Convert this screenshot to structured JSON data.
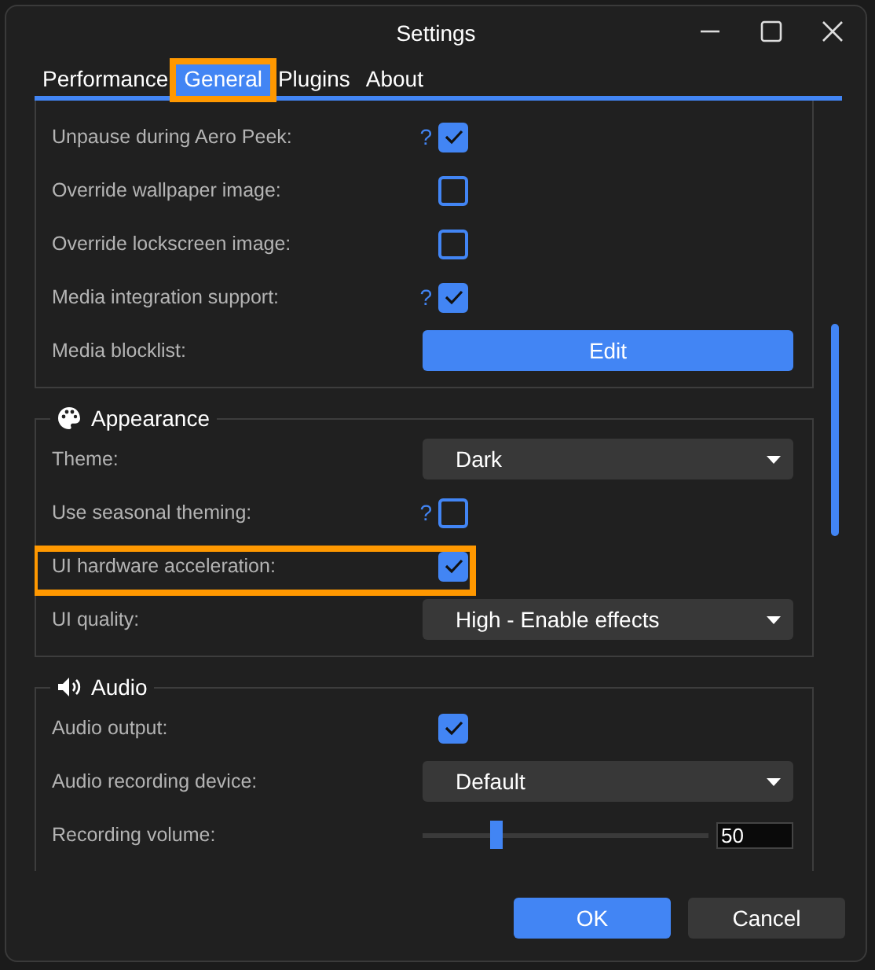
{
  "window": {
    "title": "Settings"
  },
  "tabs": [
    {
      "label": "Performance",
      "selected": false,
      "highlighted": false
    },
    {
      "label": "General",
      "selected": true,
      "highlighted": true
    },
    {
      "label": "Plugins",
      "selected": false,
      "highlighted": false
    },
    {
      "label": "About",
      "selected": false,
      "highlighted": false
    }
  ],
  "sections": [
    {
      "rows": [
        {
          "kind": "checkbox",
          "label": "Unpause during Aero Peek:",
          "help": "?",
          "checked": true
        },
        {
          "kind": "checkbox",
          "label": "Override wallpaper image:",
          "checked": false
        },
        {
          "kind": "checkbox",
          "label": "Override lockscreen image:",
          "checked": false
        },
        {
          "kind": "checkbox",
          "label": "Media integration support:",
          "help": "?",
          "checked": true
        },
        {
          "kind": "button",
          "label": "Media blocklist:",
          "button": "Edit"
        }
      ]
    },
    {
      "title": "Appearance",
      "rows": [
        {
          "kind": "dropdown",
          "label": "Theme:",
          "value": "Dark"
        },
        {
          "kind": "checkbox",
          "label": "Use seasonal theming:",
          "help": "?",
          "checked": false
        },
        {
          "kind": "checkbox",
          "label": "UI hardware acceleration:",
          "checked": true,
          "highlighted": true
        },
        {
          "kind": "dropdown",
          "label": "UI quality:",
          "value": "High - Enable effects"
        }
      ]
    },
    {
      "title": "Audio",
      "rows": [
        {
          "kind": "checkbox",
          "label": "Audio output:",
          "checked": true
        },
        {
          "kind": "dropdown",
          "label": "Audio recording device:",
          "value": "Default"
        },
        {
          "kind": "slider",
          "label": "Recording volume:",
          "level": 0.26,
          "value": "50"
        }
      ]
    }
  ],
  "buttons": [
    {
      "label": "OK",
      "primary": true
    },
    {
      "label": "Cancel",
      "primary": false
    }
  ]
}
